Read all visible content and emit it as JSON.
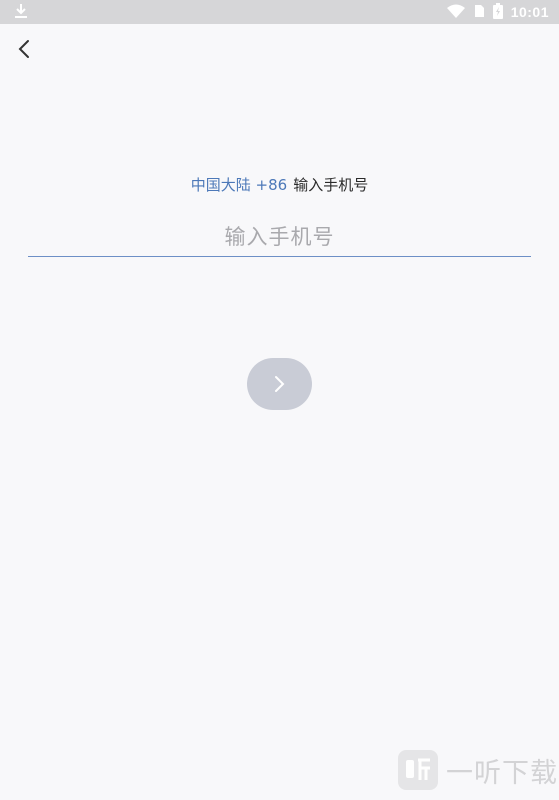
{
  "status_bar": {
    "time": "10:01",
    "download_icon": "download-icon",
    "wifi_icon": "wifi-icon",
    "sim_icon": "sim-icon",
    "battery_icon": "battery-charging-icon"
  },
  "nav": {
    "back_icon": "chevron-left-icon"
  },
  "prompt": {
    "region_code": "中国大陆 +86",
    "label": "输入手机号"
  },
  "phone_input": {
    "placeholder": "输入手机号",
    "value": ""
  },
  "next_button": {
    "icon": "chevron-right-icon"
  },
  "watermark": {
    "brand": "一听下载"
  },
  "colors": {
    "accent_blue": "#4c78b8",
    "underline": "#6d8fc6",
    "button_disabled": "#c9ccd6",
    "background": "#f8f8fa"
  }
}
